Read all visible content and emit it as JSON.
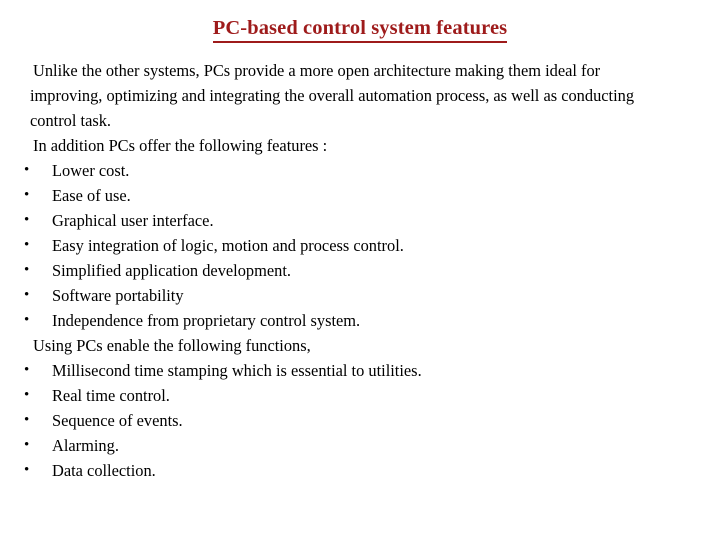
{
  "slide": {
    "title": "PC-based control system features",
    "title_color": "#9e1b1b",
    "background_color": "#ffffff",
    "text_color": "#000000",
    "bullet_glyph": "•",
    "intro_paragraph": {
      "lines": [
        "Unlike the other systems, PCs provide a more open architecture making them ideal for",
        "improving, optimizing and integrating the overall automation process, as well as conducting",
        "control task."
      ]
    },
    "features_lead_in": "In addition PCs offer the following features :",
    "features": [
      "Lower cost.",
      "Ease of use.",
      "Graphical user interface.",
      "Easy integration of logic, motion and process control.",
      "Simplified application development.",
      "Software portability",
      "Independence from proprietary control system."
    ],
    "functions_lead_in": "Using PCs enable the following functions,",
    "functions": [
      "Millisecond time stamping which is essential to utilities.",
      "Real time control.",
      "Sequence of events.",
      "Alarming.",
      "Data collection."
    ]
  }
}
